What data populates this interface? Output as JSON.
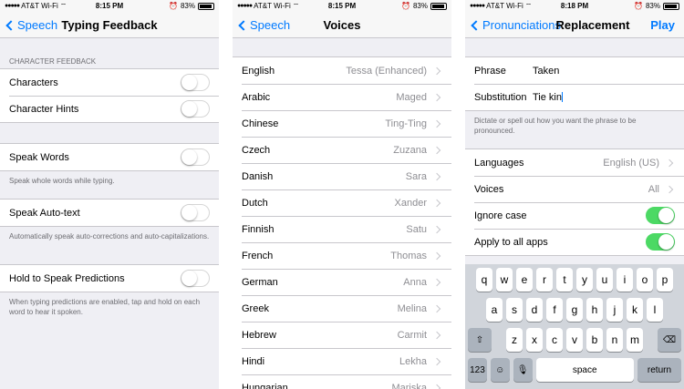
{
  "status": {
    "carrier": "AT&T Wi-Fi",
    "battery": "83%",
    "times": [
      "8:15 PM",
      "8:15 PM",
      "8:18 PM"
    ]
  },
  "panel1": {
    "back": "Speech",
    "title": "Typing Feedback",
    "section_header": "CHARACTER FEEDBACK",
    "row_characters": "Characters",
    "row_character_hints": "Character Hints",
    "row_speak_words": "Speak Words",
    "footer_speak_words": "Speak whole words while typing.",
    "row_speak_autotext": "Speak Auto-text",
    "footer_speak_autotext": "Automatically speak auto-corrections and auto-capitalizations.",
    "row_hold_predictions": "Hold to Speak Predictions",
    "footer_hold_predictions": "When typing predictions are enabled, tap and hold on each word to hear it spoken.",
    "toggles": {
      "characters": false,
      "character_hints": false,
      "speak_words": false,
      "speak_autotext": false,
      "hold_predictions": false
    }
  },
  "panel2": {
    "back": "Speech",
    "title": "Voices",
    "voices": [
      {
        "language": "English",
        "voice": "Tessa (Enhanced)"
      },
      {
        "language": "Arabic",
        "voice": "Maged"
      },
      {
        "language": "Chinese",
        "voice": "Ting-Ting"
      },
      {
        "language": "Czech",
        "voice": "Zuzana"
      },
      {
        "language": "Danish",
        "voice": "Sara"
      },
      {
        "language": "Dutch",
        "voice": "Xander"
      },
      {
        "language": "Finnish",
        "voice": "Satu"
      },
      {
        "language": "French",
        "voice": "Thomas"
      },
      {
        "language": "German",
        "voice": "Anna"
      },
      {
        "language": "Greek",
        "voice": "Melina"
      },
      {
        "language": "Hebrew",
        "voice": "Carmit"
      },
      {
        "language": "Hindi",
        "voice": "Lekha"
      },
      {
        "language": "Hungarian",
        "voice": "Mariska"
      }
    ]
  },
  "panel3": {
    "back": "Pronunciations",
    "title": "Replacement",
    "play": "Play",
    "phrase_label": "Phrase",
    "phrase_value": "Taken",
    "substitution_label": "Substitution",
    "substitution_value": "Tie kin",
    "hint": "Dictate or spell out how you want the phrase to be pronounced.",
    "languages_label": "Languages",
    "languages_value": "English (US)",
    "voices_label": "Voices",
    "voices_value": "All",
    "ignore_case_label": "Ignore case",
    "apply_all_label": "Apply to all apps",
    "toggles": {
      "ignore_case": true,
      "apply_all": true
    }
  },
  "keyboard": {
    "row1": [
      "q",
      "w",
      "e",
      "r",
      "t",
      "y",
      "u",
      "i",
      "o",
      "p"
    ],
    "row2": [
      "a",
      "s",
      "d",
      "f",
      "g",
      "h",
      "j",
      "k",
      "l"
    ],
    "row3": [
      "z",
      "x",
      "c",
      "v",
      "b",
      "n",
      "m"
    ],
    "numbers_key": "123",
    "space_key": "space",
    "return_key": "return"
  },
  "colors": {
    "accent": "#007aff",
    "toggle_on": "#4cd964",
    "background": "#efeff4"
  }
}
